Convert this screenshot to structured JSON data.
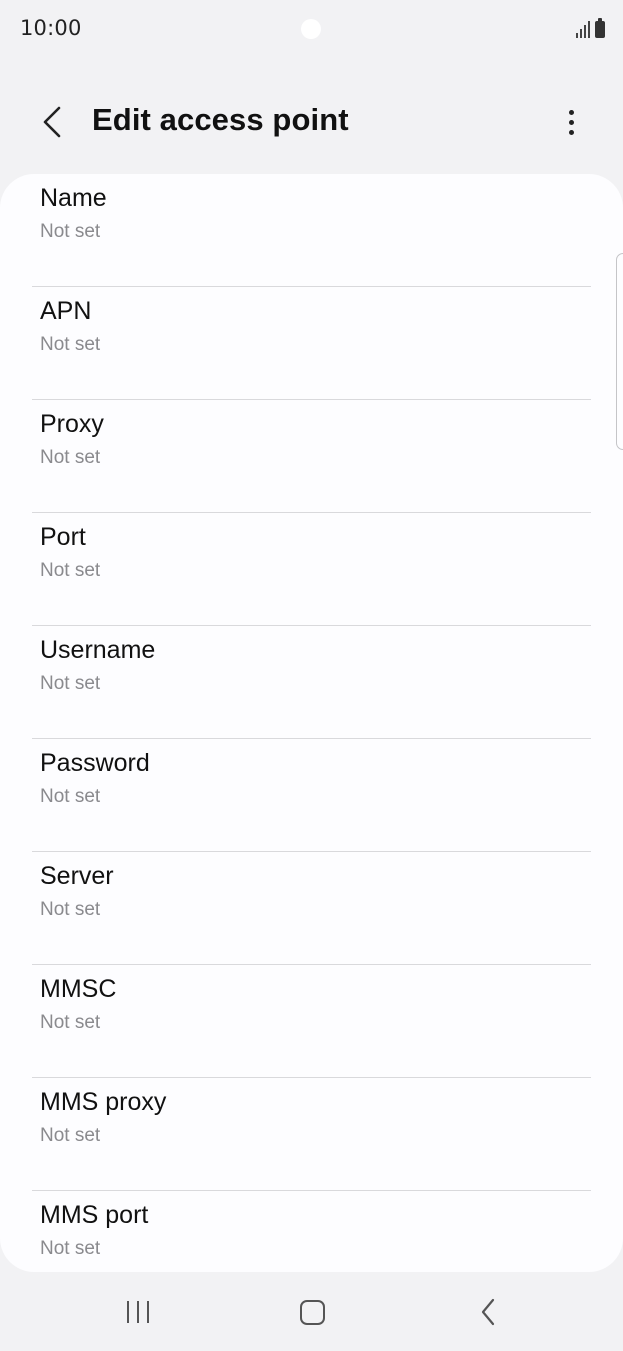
{
  "status_bar": {
    "time": "10:00",
    "icons": [
      "signal-icon",
      "battery-icon"
    ]
  },
  "app_bar": {
    "title": "Edit access point",
    "back_icon": "chevron-left-icon",
    "more_icon": "more-vertical-icon"
  },
  "settings": {
    "items": [
      {
        "title": "Name",
        "value": "Not set"
      },
      {
        "title": "APN",
        "value": "Not set"
      },
      {
        "title": "Proxy",
        "value": "Not set"
      },
      {
        "title": "Port",
        "value": "Not set"
      },
      {
        "title": "Username",
        "value": "Not set"
      },
      {
        "title": "Password",
        "value": "Not set"
      },
      {
        "title": "Server",
        "value": "Not set"
      },
      {
        "title": "MMSC",
        "value": "Not set"
      },
      {
        "title": "MMS proxy",
        "value": "Not set"
      },
      {
        "title": "MMS port",
        "value": "Not set"
      }
    ]
  },
  "nav_bar": {
    "icons": [
      "recents-icon",
      "home-icon",
      "back-icon"
    ]
  },
  "colors": {
    "background": "#f2f2f4",
    "card": "#fdfdff",
    "title_text": "#111111",
    "secondary_text": "#8a8a8e",
    "divider": "#d9d9dc"
  }
}
